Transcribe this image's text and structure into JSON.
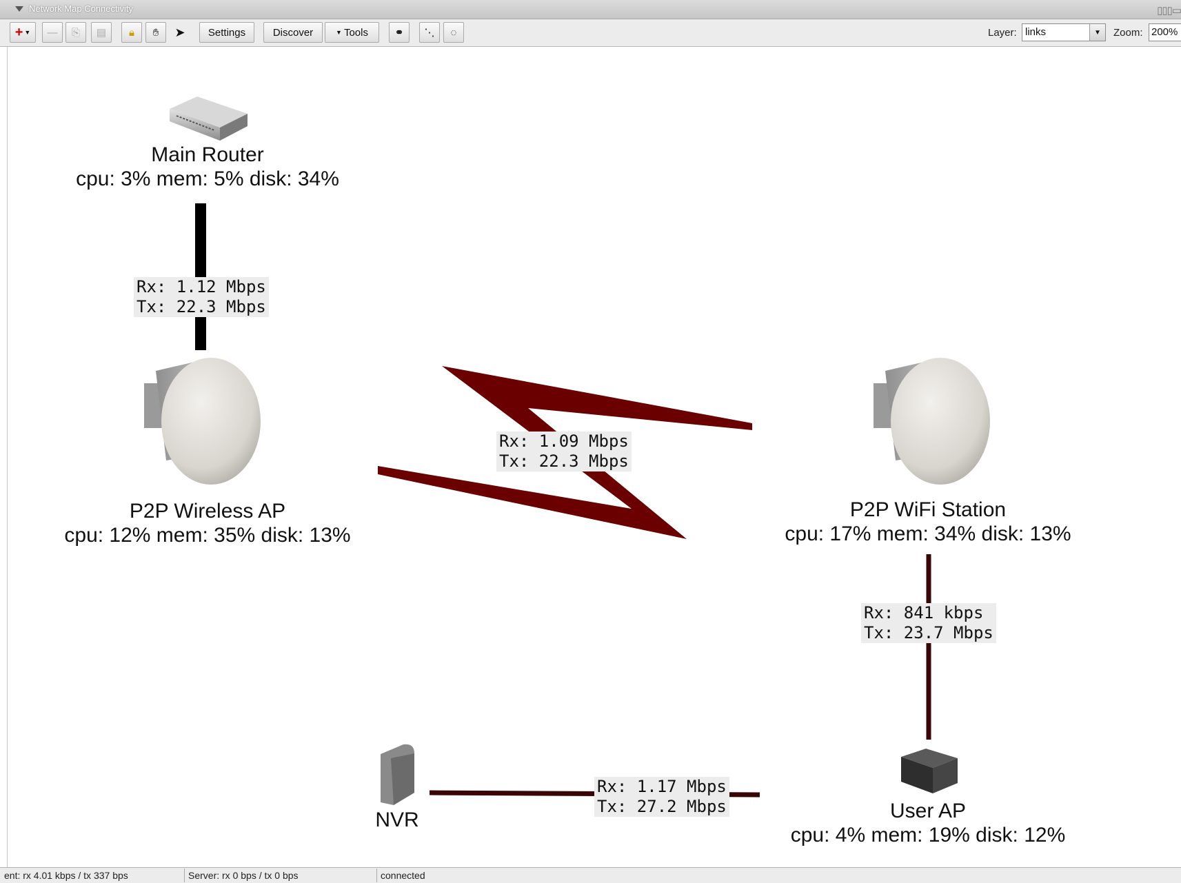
{
  "window": {
    "title": "Network Map Connectivity"
  },
  "toolbar": {
    "settings_label": "Settings",
    "discover_label": "Discover",
    "tools_label": "Tools",
    "layer_label": "Layer:",
    "layer_value": "links",
    "zoom_label": "Zoom:",
    "zoom_value": "200%"
  },
  "nodes": {
    "main_router": {
      "name": "Main Router",
      "stats": "cpu: 3% mem: 5% disk: 34%"
    },
    "p2p_ap": {
      "name": "P2P Wireless AP",
      "stats": "cpu: 12% mem: 35% disk: 13%"
    },
    "p2p_station": {
      "name": "P2P WiFi Station",
      "stats": "cpu: 17% mem: 34% disk: 13%"
    },
    "user_ap": {
      "name": "User AP",
      "stats": "cpu: 4% mem: 19% disk: 12%"
    },
    "nvr": {
      "name": "NVR"
    }
  },
  "links": {
    "router_ap": {
      "rx": "Rx: 1.12 Mbps",
      "tx": "Tx: 22.3 Mbps"
    },
    "wireless": {
      "rx": "Rx: 1.09 Mbps",
      "tx": "Tx: 22.3 Mbps"
    },
    "station_userap": {
      "rx": "Rx: 841 kbps",
      "tx": "Tx: 23.7 Mbps"
    },
    "nvr_userap": {
      "rx": "Rx: 1.17 Mbps",
      "tx": "Tx: 27.2 Mbps"
    }
  },
  "status": {
    "client": "ent: rx 4.01 kbps / tx 337 bps",
    "server": "Server: rx 0 bps / tx 0 bps",
    "connection": "connected"
  },
  "colors": {
    "wired_link": "#000000",
    "wireless_link": "#6b0000",
    "dark_link": "#3a0505"
  }
}
